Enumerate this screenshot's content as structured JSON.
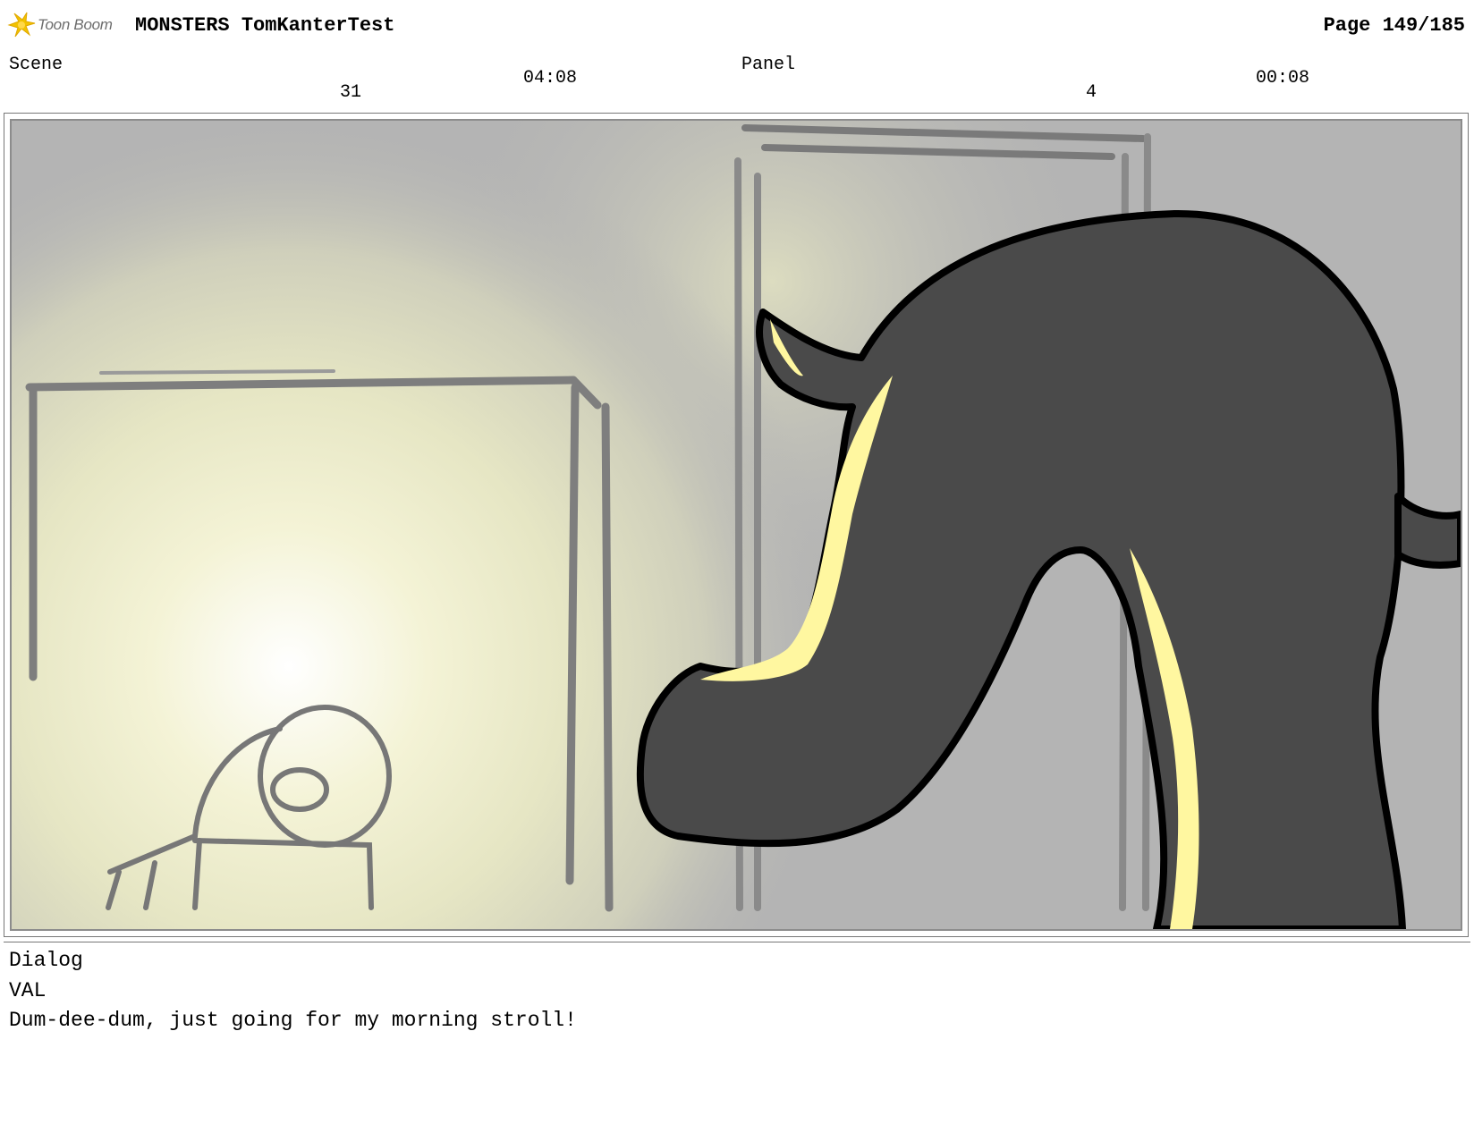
{
  "header": {
    "logo_text": "Toon Boom",
    "logo_icon": "toon-boom-star-icon",
    "project_title": "MONSTERS TomKanterTest",
    "page": "Page 149/185"
  },
  "scene": {
    "label": "Scene",
    "number": "31",
    "duration": "04:08"
  },
  "panel": {
    "label": "Panel",
    "number": "4",
    "duration": "00:08"
  },
  "dialog": {
    "label": "Dialog",
    "speaker": "VAL",
    "line": "Dum-dee-dum, just going for my morning stroll!"
  },
  "colors": {
    "creature_body": "#4a4a4a",
    "highlight": "#fff7a0",
    "background": "#b4b4b4",
    "light_glow": "#f3f1cc",
    "logo_star": "#f2c200"
  }
}
